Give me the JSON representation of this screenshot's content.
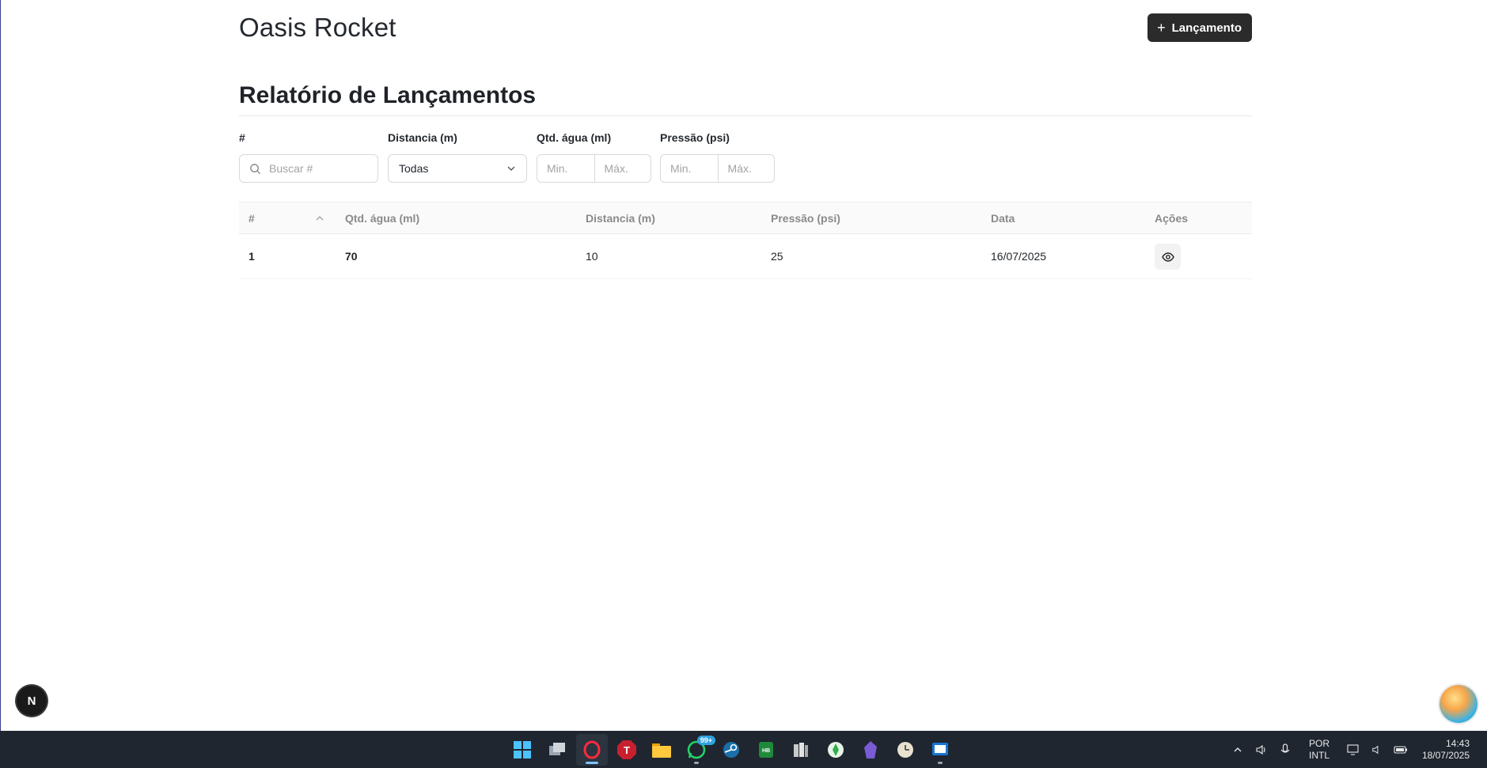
{
  "header": {
    "app_title": "Oasis Rocket",
    "new_button_label": "Lançamento"
  },
  "report": {
    "title": "Relatório de Lançamentos"
  },
  "filters": {
    "id": {
      "label": "#",
      "placeholder": "Buscar #"
    },
    "distance": {
      "label": "Distancia (m)",
      "selected": "Todas"
    },
    "water": {
      "label": "Qtd. água (ml)",
      "min_placeholder": "Min.",
      "max_placeholder": "Máx."
    },
    "pressure": {
      "label": "Pressão (psi)",
      "min_placeholder": "Min.",
      "max_placeholder": "Máx."
    }
  },
  "table": {
    "columns": [
      "#",
      "Qtd. água (ml)",
      "Distancia (m)",
      "Pressão (psi)",
      "Data",
      "Ações"
    ],
    "rows": [
      {
        "id": "1",
        "water": "70",
        "distance": "10",
        "pressure": "25",
        "date": "16/07/2025"
      }
    ]
  },
  "overlay": {
    "dev_badge_letter": "N"
  },
  "taskbar": {
    "apps": [
      "start-icon",
      "task-view-icon",
      "opera-browser-icon",
      "t-app-icon",
      "file-explorer-icon",
      "whatsapp-icon",
      "steam-icon",
      "hebuvi-icon",
      "archive-app-icon",
      "sims-icon",
      "obsidian-icon",
      "clock-app-icon",
      "remote-desktop-icon"
    ],
    "whatsapp_badge": "99+",
    "language_top": "POR",
    "language_bottom": "INTL",
    "time": "14:43",
    "date": "18/07/2025"
  },
  "colors": {
    "primary_button": "#2b2b2b",
    "taskbar": "#1f2630",
    "accent": "#7cc6ff"
  }
}
